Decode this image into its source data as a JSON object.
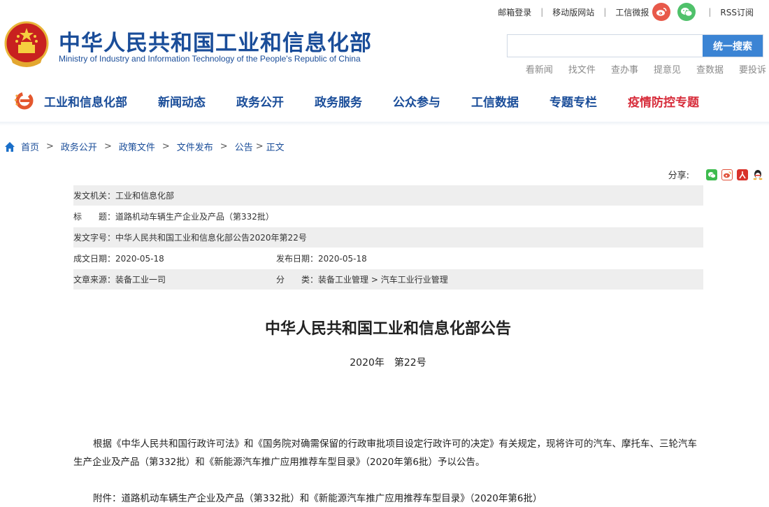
{
  "header": {
    "title": "中华人民共和国工业和信息化部",
    "subtitle": "Ministry of Industry and Information Technology of the People's Republic of China",
    "toplinks": {
      "mail": "邮箱登录",
      "mobile": "移动版网站",
      "weibo": "工信微报",
      "rss": "RSS订阅"
    },
    "search": {
      "placeholder": "",
      "button": "统一搜索"
    },
    "quicklinks": [
      "看新闻",
      "找文件",
      "查办事",
      "提意见",
      "查数据",
      "要投诉"
    ]
  },
  "nav": {
    "items": [
      "工业和信息化部",
      "新闻动态",
      "政务公开",
      "政务服务",
      "公众参与",
      "工信数据",
      "专题专栏",
      "疫情防控专题"
    ]
  },
  "breadcrumb": {
    "items": [
      "首页",
      "政务公开",
      "政策文件",
      "文件发布",
      "公告",
      "正文"
    ]
  },
  "share": {
    "label": "分享:"
  },
  "info": {
    "issuer_label": "发文机关：",
    "issuer": "工业和信息化部",
    "title_label": "标　　题：",
    "title": "道路机动车辆生产企业及产品（第332批）",
    "docno_label": "发文字号：",
    "docno": "中华人民共和国工业和信息化部公告2020年第22号",
    "created_label": "成文日期：",
    "created": "2020-05-18",
    "published_label": "发布日期：",
    "published": "2020-05-18",
    "source_label": "文章来源：",
    "source": "装备工业一司",
    "category_label": "分　　类：",
    "category": "装备工业管理 > 汽车工业行业管理"
  },
  "article": {
    "title": "中华人民共和国工业和信息化部公告",
    "number": "2020年　第22号",
    "paragraph": "根据《中华人民共和国行政许可法》和《国务院对确需保留的行政审批项目设定行政许可的决定》有关规定，现将许可的汽车、摩托车、三轮汽车生产企业及产品（第332批）和《新能源汽车推广应用推荐车型目录》（2020年第6批）予以公告。",
    "attachment": "附件：道路机动车辆生产企业及产品（第332批）和《新能源汽车推广应用推荐车型目录》（2020年第6批）"
  }
}
